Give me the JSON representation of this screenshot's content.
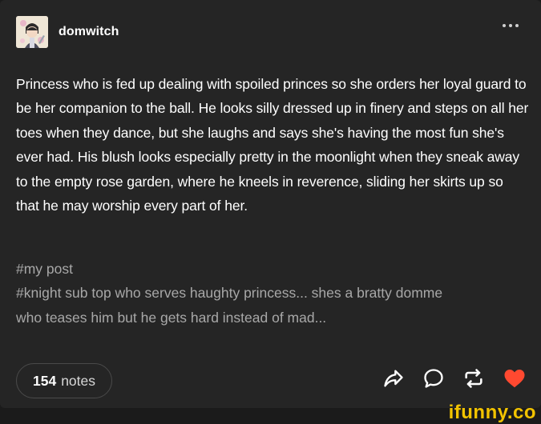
{
  "post": {
    "username": "domwitch",
    "body": "Princess who is fed up dealing with spoiled princes so she orders her loyal guard to be her companion to the ball. He looks silly dressed up in finery and steps on all her toes when they dance, but she laughs and says she's having the most fun she's ever had. His blush looks especially pretty in the moonlight when they sneak away to the empty rose garden, where he kneels in reverence, sliding her skirts up so that he may worship every part of her.",
    "tags": [
      "#my post",
      "#knight sub top who serves haughty princess... shes a bratty domme",
      "who teases him but he gets hard instead of mad..."
    ],
    "notes_count": "154",
    "notes_label": "notes"
  },
  "icons": {
    "more": "more-options-icon",
    "share": "share-icon",
    "reply": "reply-icon",
    "reblog": "reblog-icon",
    "like": "heart-icon"
  },
  "colors": {
    "background": "#252525",
    "like": "#ff4930",
    "watermark": "#f2c300"
  },
  "watermark": "ifunny.co"
}
